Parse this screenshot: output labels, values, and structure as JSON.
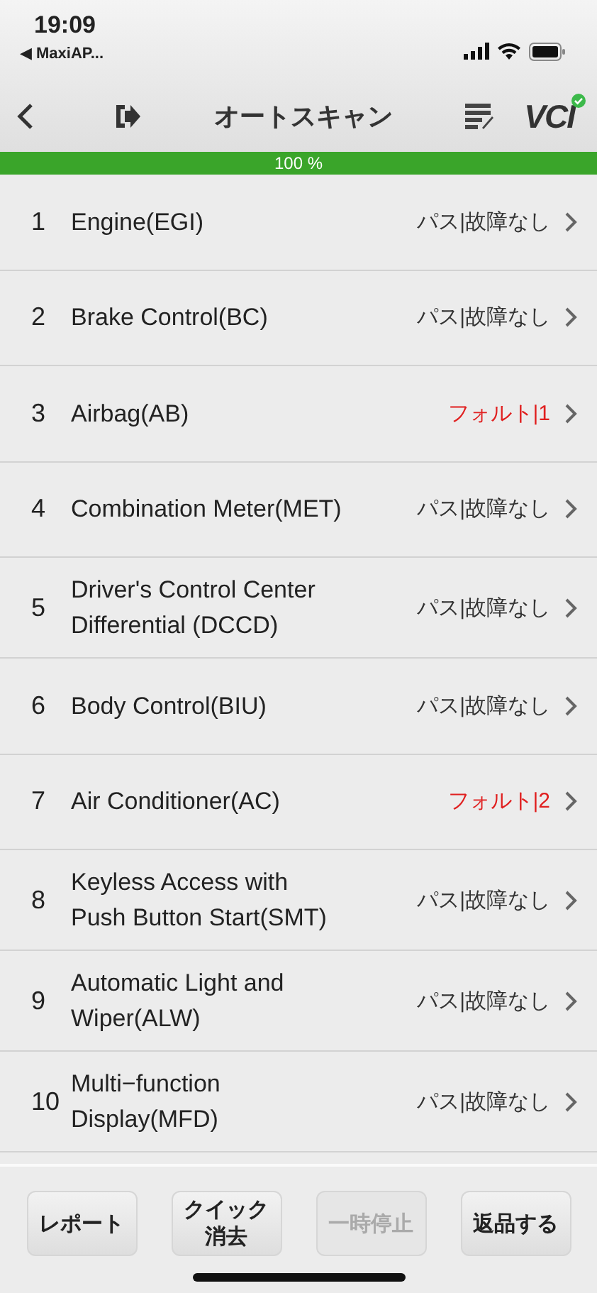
{
  "status_bar": {
    "time": "19:09",
    "back_app": "◀ MaxiAP..."
  },
  "nav": {
    "title": "オートスキャン",
    "logo": "VCI",
    "connected": true
  },
  "progress": {
    "level": 1,
    "label": "100 %"
  },
  "systems": [
    {
      "number": "1",
      "name": "Engine(EGI)",
      "result": "パス|故障なし",
      "kind": "pass"
    },
    {
      "number": "2",
      "name": "Brake Control(BC)",
      "result": "パス|故障なし",
      "kind": "pass"
    },
    {
      "number": "3",
      "name": "Airbag(AB)",
      "result": "フォルト|1",
      "kind": "fault"
    },
    {
      "number": "4",
      "name": "Combination Meter(MET)",
      "result": "パス|故障なし",
      "kind": "pass"
    },
    {
      "number": "5",
      "name": "Driver's Control Center Differential (DCCD)",
      "result": "パス|故障なし",
      "kind": "pass"
    },
    {
      "number": "6",
      "name": "Body Control(BIU)",
      "result": "パス|故障なし",
      "kind": "pass"
    },
    {
      "number": "7",
      "name": "Air Conditioner(AC)",
      "result": "フォルト|2",
      "kind": "fault"
    },
    {
      "number": "8",
      "name": "Keyless Access with Push Button Start(SMT)",
      "result": "パス|故障なし",
      "kind": "pass"
    },
    {
      "number": "9",
      "name": "Automatic Light and Wiper(ALW)",
      "result": "パス|故障なし",
      "kind": "pass"
    },
    {
      "number": "10",
      "name": "Multi−function Display(MFD)",
      "result": "パス|故障なし",
      "kind": "pass"
    }
  ],
  "buttons": [
    {
      "label": "レポート",
      "disabled": false
    },
    {
      "label": "クイック消去",
      "disabled": false
    },
    {
      "label": "一時停止",
      "disabled": true
    },
    {
      "label": "返品する",
      "disabled": false
    }
  ]
}
